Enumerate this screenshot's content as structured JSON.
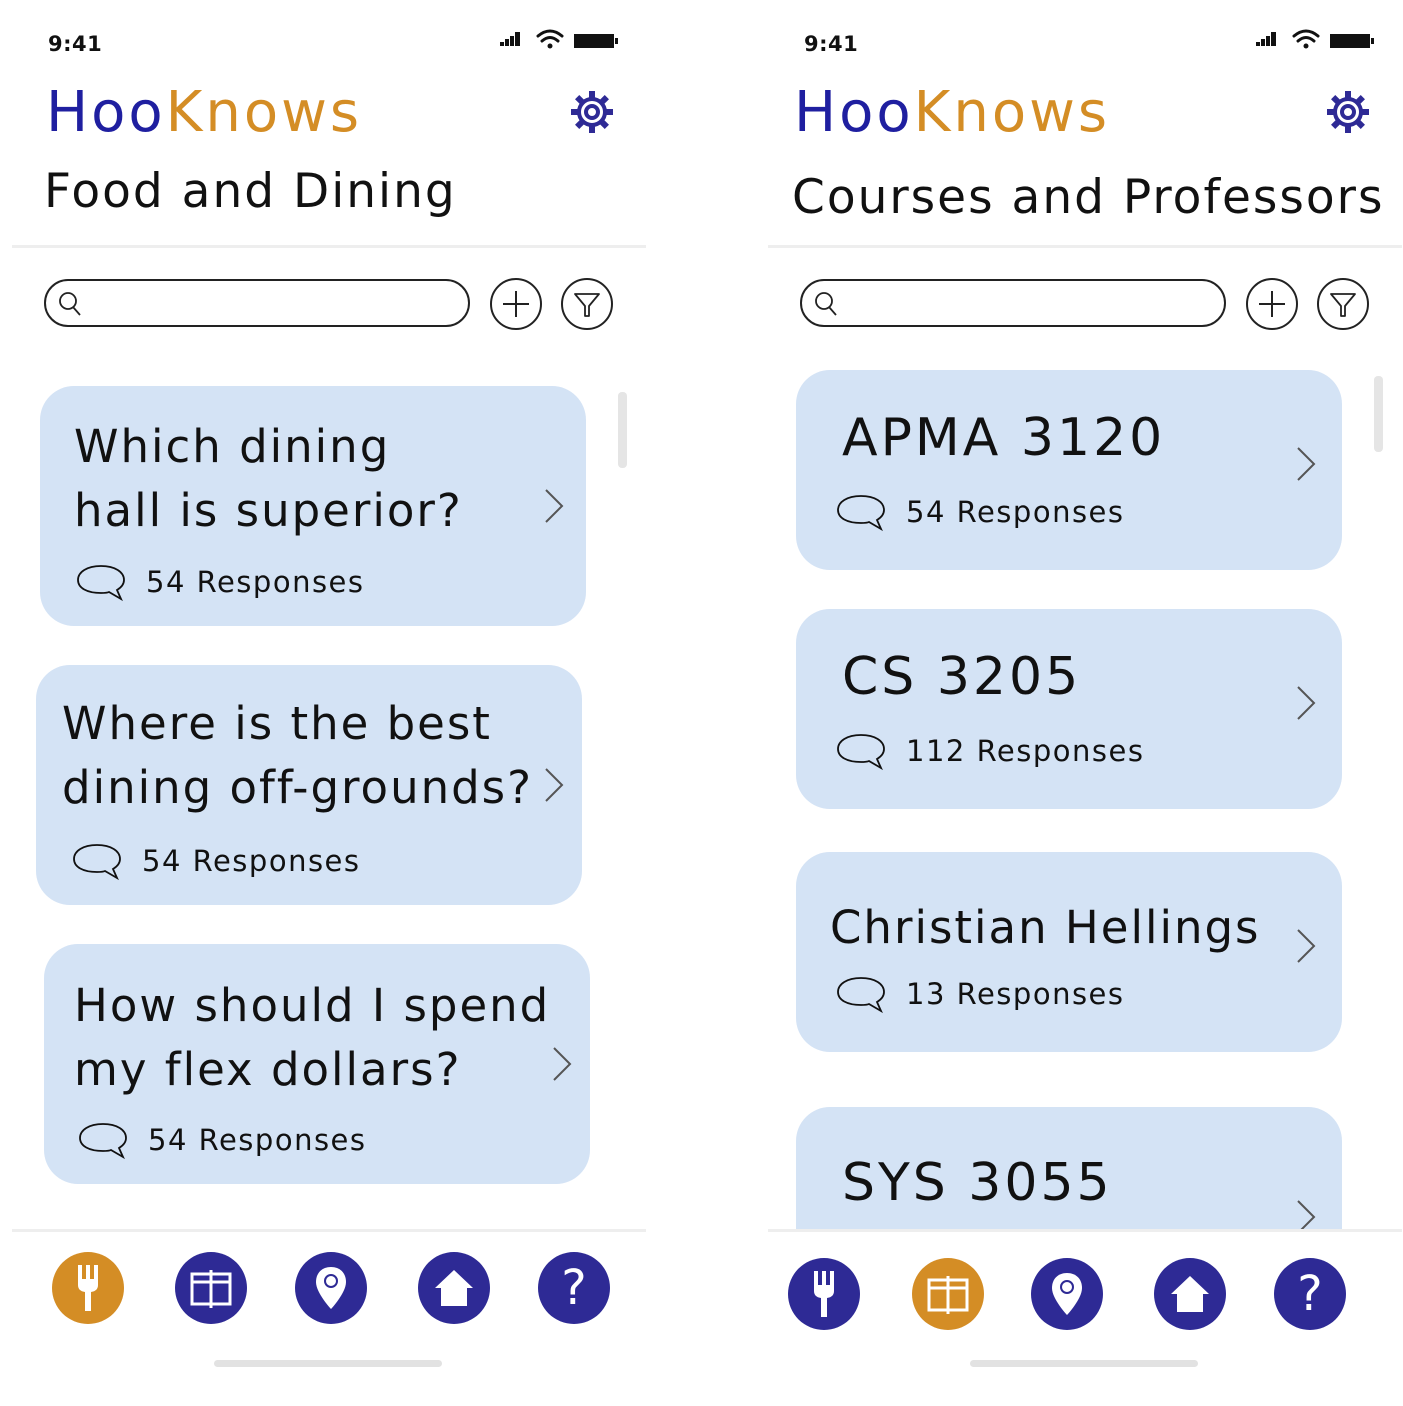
{
  "colors": {
    "brand_blue": "#1f1fa0",
    "brand_orange": "#d48d25",
    "card_bg": "#d4e3f5",
    "tab_inactive": "#2e2a95"
  },
  "left": {
    "status": {
      "time": "9:41"
    },
    "header": {
      "logo_part1": "Hoo",
      "logo_part2": "Knows",
      "section_title": "Food and Dining"
    },
    "search": {
      "placeholder": ""
    },
    "cards": [
      {
        "title_line1": "Which dining",
        "title_line2": "hall is superior?",
        "responses": "54 Responses"
      },
      {
        "title_line1": "Where is the best",
        "title_line2": "dining off-grounds?",
        "responses": "54 Responses"
      },
      {
        "title_line1": "How should I spend",
        "title_line2": "my flex dollars?",
        "responses": "54 Responses"
      }
    ],
    "tabs": [
      {
        "icon": "fork-icon",
        "active": true
      },
      {
        "icon": "book-icon",
        "active": false
      },
      {
        "icon": "location-pin-icon",
        "active": false
      },
      {
        "icon": "home-icon",
        "active": false
      },
      {
        "icon": "question-icon",
        "active": false
      }
    ],
    "question_glyph": "?"
  },
  "right": {
    "status": {
      "time": "9:41"
    },
    "header": {
      "logo_part1": "Hoo",
      "logo_part2": "Knows",
      "section_title": "Courses and Professors"
    },
    "search": {
      "placeholder": ""
    },
    "cards": [
      {
        "title": "APMA 3120",
        "responses": "54 Responses"
      },
      {
        "title": "CS 3205",
        "responses": "112 Responses"
      },
      {
        "title": "Christian Hellings",
        "responses": "13 Responses"
      },
      {
        "title": "SYS 3055",
        "responses": ""
      }
    ],
    "tabs": [
      {
        "icon": "fork-icon",
        "active": false
      },
      {
        "icon": "book-icon",
        "active": true
      },
      {
        "icon": "location-pin-icon",
        "active": false
      },
      {
        "icon": "home-icon",
        "active": false
      },
      {
        "icon": "question-icon",
        "active": false
      }
    ],
    "question_glyph": "?"
  }
}
